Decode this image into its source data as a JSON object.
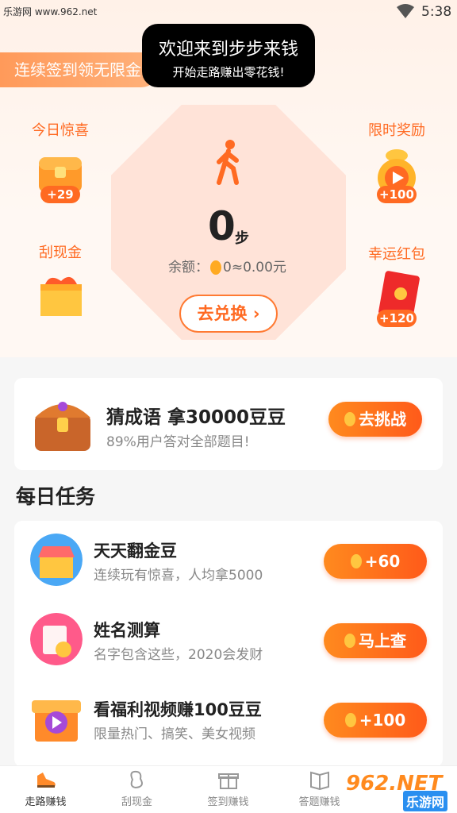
{
  "status_bar": {
    "site": "乐游网 www.962.net",
    "time": "5:38"
  },
  "banner": {
    "signin_text": "连续签到领无限金"
  },
  "toast": {
    "title": "欢迎来到步步来钱",
    "subtitle": "开始走路赚出零花钱!"
  },
  "pedometer": {
    "steps": "0",
    "steps_unit": "步",
    "balance_label": "余额：",
    "balance_beans": "0",
    "balance_value": "≈0.00元",
    "exchange_button": "去兑换"
  },
  "side_items": [
    {
      "label": "今日惊喜",
      "badge": "+29"
    },
    {
      "label": "刮现金",
      "badge": ""
    },
    {
      "label": "限时奖励",
      "badge": "+100"
    },
    {
      "label": "幸运红包",
      "badge": "+120"
    }
  ],
  "quiz": {
    "title": "猜成语 拿30000豆豆",
    "subtitle": "89%用户答对全部题目!",
    "button": "去挑战"
  },
  "daily_tasks": {
    "section_title": "每日任务",
    "items": [
      {
        "title": "天天翻金豆",
        "subtitle": "连续玩有惊喜，人均拿5000",
        "button": "+60"
      },
      {
        "title": "姓名测算",
        "subtitle": "名字包含这些，2020会发财",
        "button": "马上查"
      },
      {
        "title": "看福利视频赚100豆豆",
        "subtitle": "限量热门、搞笑、美女视频",
        "button": "+100"
      }
    ]
  },
  "bottom_nav": [
    {
      "label": "走路赚钱"
    },
    {
      "label": "刮现金"
    },
    {
      "label": "签到赚钱"
    },
    {
      "label": "答题赚钱"
    }
  ],
  "watermark": {
    "logo": "962.NET",
    "text": "乐游网"
  },
  "colors": {
    "accent": "#ff6a22",
    "button_start": "#ff8a1e",
    "button_end": "#ff5a1a",
    "octagon": "#ffe3d8"
  }
}
